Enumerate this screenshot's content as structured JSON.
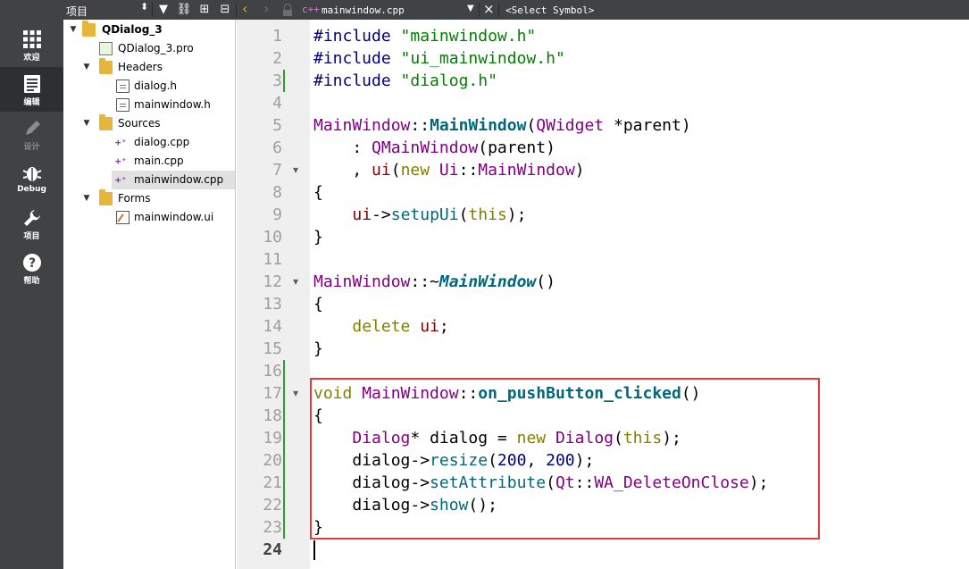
{
  "toolbar": {
    "project_label": "项目",
    "open_file": "mainwindow.cpp",
    "symbol_placeholder": "<Select Symbol>"
  },
  "modes": [
    {
      "label": "欢迎",
      "icon": "grid-icon"
    },
    {
      "label": "编辑",
      "icon": "edit-icon"
    },
    {
      "label": "设计",
      "icon": "pencil-icon"
    },
    {
      "label": "Debug",
      "icon": "bug-icon"
    },
    {
      "label": "项目",
      "icon": "wrench-icon"
    },
    {
      "label": "帮助",
      "icon": "help-icon"
    }
  ],
  "tree": {
    "items": [
      {
        "label": "QDialog_3",
        "icon": "project-icon"
      },
      {
        "label": "QDialog_3.pro",
        "icon": "pro-file-icon"
      },
      {
        "label": "Headers",
        "icon": "folder-icon"
      },
      {
        "label": "dialog.h",
        "icon": "header-file-icon"
      },
      {
        "label": "mainwindow.h",
        "icon": "header-file-icon"
      },
      {
        "label": "Sources",
        "icon": "folder-icon"
      },
      {
        "label": "dialog.cpp",
        "icon": "cpp-file-icon"
      },
      {
        "label": "main.cpp",
        "icon": "cpp-file-icon"
      },
      {
        "label": "mainwindow.cpp",
        "icon": "cpp-file-icon"
      },
      {
        "label": "Forms",
        "icon": "folder-icon"
      },
      {
        "label": "mainwindow.ui",
        "icon": "ui-file-icon"
      }
    ]
  },
  "editor": {
    "line_numbers": [
      "1",
      "2",
      "3",
      "4",
      "5",
      "6",
      "7",
      "8",
      "9",
      "10",
      "11",
      "12",
      "13",
      "14",
      "15",
      "16",
      "17",
      "18",
      "19",
      "20",
      "21",
      "22",
      "23",
      "24"
    ],
    "current_line": "24",
    "lines": [
      [
        [
          "pre",
          "#include "
        ],
        [
          "str",
          "\"mainwindow.h\""
        ]
      ],
      [
        [
          "pre",
          "#include "
        ],
        [
          "str",
          "\"ui_mainwindow.h\""
        ]
      ],
      [
        [
          "pre",
          "#include "
        ],
        [
          "str",
          "\"dialog.h\""
        ]
      ],
      [],
      [
        [
          "cls",
          "MainWindow"
        ],
        [
          "plain",
          "::"
        ],
        [
          "fnb",
          "MainWindow"
        ],
        [
          "plain",
          "("
        ],
        [
          "cls",
          "QWidget"
        ],
        [
          "plain",
          " *"
        ],
        [
          "plain",
          "parent)"
        ]
      ],
      [
        [
          "plain",
          "    : "
        ],
        [
          "cls",
          "QMainWindow"
        ],
        [
          "plain",
          "(parent)"
        ]
      ],
      [
        [
          "plain",
          "    , "
        ],
        [
          "mem",
          "ui"
        ],
        [
          "plain",
          "("
        ],
        [
          "kw",
          "new "
        ],
        [
          "cls",
          "Ui"
        ],
        [
          "plain",
          "::"
        ],
        [
          "cls",
          "MainWindow"
        ],
        [
          "plain",
          ")"
        ]
      ],
      [
        [
          "plain",
          "{"
        ]
      ],
      [
        [
          "plain",
          "    "
        ],
        [
          "mem",
          "ui"
        ],
        [
          "plain",
          "->"
        ],
        [
          "fn",
          "setupUi"
        ],
        [
          "plain",
          "("
        ],
        [
          "kw",
          "this"
        ],
        [
          "plain",
          ");"
        ]
      ],
      [
        [
          "plain",
          "}"
        ]
      ],
      [],
      [
        [
          "cls",
          "MainWindow"
        ],
        [
          "plain",
          "::~"
        ],
        [
          "fni",
          "MainWindow"
        ],
        [
          "plain",
          "()"
        ]
      ],
      [
        [
          "plain",
          "{"
        ]
      ],
      [
        [
          "plain",
          "    "
        ],
        [
          "kw",
          "delete "
        ],
        [
          "mem",
          "ui"
        ],
        [
          "plain",
          ";"
        ]
      ],
      [
        [
          "plain",
          "}"
        ]
      ],
      [],
      [
        [
          "kw",
          "void "
        ],
        [
          "cls",
          "MainWindow"
        ],
        [
          "plain",
          "::"
        ],
        [
          "fnb",
          "on_pushButton_clicked"
        ],
        [
          "plain",
          "()"
        ]
      ],
      [
        [
          "plain",
          "{"
        ]
      ],
      [
        [
          "plain",
          "    "
        ],
        [
          "cls",
          "Dialog"
        ],
        [
          "plain",
          "* dialog = "
        ],
        [
          "kw",
          "new "
        ],
        [
          "cls",
          "Dialog"
        ],
        [
          "plain",
          "("
        ],
        [
          "kw",
          "this"
        ],
        [
          "plain",
          ");"
        ]
      ],
      [
        [
          "plain",
          "    dialog->"
        ],
        [
          "fn",
          "resize"
        ],
        [
          "plain",
          "("
        ],
        [
          "num",
          "200"
        ],
        [
          "plain",
          ", "
        ],
        [
          "num",
          "200"
        ],
        [
          "plain",
          ");"
        ]
      ],
      [
        [
          "plain",
          "    dialog->"
        ],
        [
          "fn",
          "setAttribute"
        ],
        [
          "plain",
          "("
        ],
        [
          "cls",
          "Qt"
        ],
        [
          "plain",
          "::"
        ],
        [
          "enum",
          "WA_DeleteOnClose"
        ],
        [
          "plain",
          ");"
        ]
      ],
      [
        [
          "plain",
          "    dialog->"
        ],
        [
          "fn",
          "show"
        ],
        [
          "plain",
          "();"
        ]
      ],
      [
        [
          "plain",
          "}"
        ]
      ],
      []
    ],
    "highlight_color": "#e03b3b"
  }
}
